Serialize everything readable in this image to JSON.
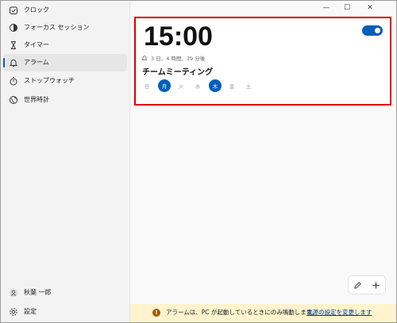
{
  "sidebar": {
    "items": [
      {
        "label": "クロック",
        "icon": "clock-icon"
      },
      {
        "label": "フォーカス セッション",
        "icon": "focus-icon"
      },
      {
        "label": "タイマー",
        "icon": "hourglass-icon"
      },
      {
        "label": "アラーム",
        "icon": "bell-icon",
        "selected": true
      },
      {
        "label": "ストップウォッチ",
        "icon": "stopwatch-icon"
      },
      {
        "label": "世界時計",
        "icon": "globe-icon"
      }
    ],
    "user": {
      "label": "秋葉 一郎",
      "icon": "person-icon"
    },
    "settings": {
      "label": "設定",
      "icon": "gear-icon"
    }
  },
  "window": {
    "controls": [
      "—",
      "☐",
      "✕"
    ]
  },
  "alarm": {
    "time": "15:00",
    "enabled": true,
    "remaining": "3 日、4 時間、39 分後",
    "name": "チームミーティング",
    "days": [
      {
        "label": "日",
        "on": false
      },
      {
        "label": "月",
        "on": true
      },
      {
        "label": "火",
        "on": false
      },
      {
        "label": "水",
        "on": false
      },
      {
        "label": "木",
        "on": true
      },
      {
        "label": "金",
        "on": false
      },
      {
        "label": "土",
        "on": false
      }
    ]
  },
  "info_bar": {
    "icon": "!",
    "message": "アラームは、PC が起動しているときにのみ鳴動します。",
    "link": "電源の設定を変更します"
  },
  "colors": {
    "accent": "#005fb8",
    "highlight": "#e00000",
    "info_bg": "#fff4ce"
  }
}
